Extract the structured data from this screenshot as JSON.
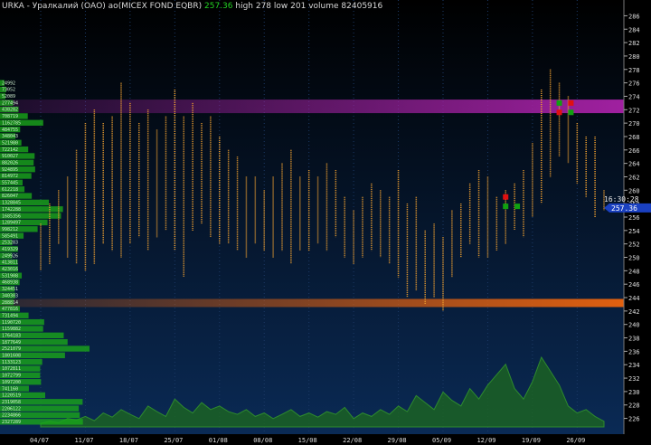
{
  "header": {
    "symbol": "URKA",
    "name": "Уралкалий (ОАО) ао(MICEX FOND EQBR)",
    "last": "257.36",
    "high_text": "high 278",
    "low_text": "low 201",
    "volume_text": "volume 82405916"
  },
  "colors": {
    "background_top": "#000000",
    "background_bottom": "#0a2a55",
    "candle": "#f0a030",
    "resistance_band": "#a020a0",
    "support_band": "#e06010",
    "volume_area": "#1e6a1e",
    "price_tag": "#1a40c0",
    "profile_bar": "#1aa61a"
  },
  "chart_data": {
    "type": "bar",
    "ylim": [
      225,
      287
    ],
    "y_ticks": [
      "286",
      "284",
      "282",
      "280",
      "278",
      "276",
      "274",
      "272",
      "270",
      "268",
      "266",
      "264",
      "262",
      "260",
      "258",
      "256",
      "254",
      "252",
      "250",
      "248",
      "246",
      "244",
      "242",
      "240",
      "238",
      "236",
      "234",
      "232",
      "230",
      "228",
      "226"
    ],
    "x_ticks": [
      "04/07",
      "11/07",
      "18/07",
      "25/07",
      "01/08",
      "08/08",
      "15/08",
      "22/08",
      "29/08",
      "05/09",
      "12/09",
      "19/09",
      "26/09"
    ],
    "x_tick_index": [
      0,
      5,
      10,
      15,
      20,
      25,
      30,
      35,
      40,
      45,
      50,
      55,
      60
    ],
    "ranges": [
      [
        248,
        255
      ],
      [
        249,
        258
      ],
      [
        252,
        260
      ],
      [
        250,
        262
      ],
      [
        249,
        266
      ],
      [
        248,
        270
      ],
      [
        249,
        272
      ],
      [
        252,
        270
      ],
      [
        251,
        271
      ],
      [
        250,
        276
      ],
      [
        252,
        273
      ],
      [
        253,
        270
      ],
      [
        251,
        272
      ],
      [
        253,
        269
      ],
      [
        254,
        271
      ],
      [
        251,
        275
      ],
      [
        247,
        271
      ],
      [
        254,
        273
      ],
      [
        255,
        270
      ],
      [
        253,
        271
      ],
      [
        252,
        268
      ],
      [
        252,
        266
      ],
      [
        251,
        265
      ],
      [
        250,
        262
      ],
      [
        252,
        262
      ],
      [
        251,
        260
      ],
      [
        250,
        262
      ],
      [
        251,
        264
      ],
      [
        249,
        266
      ],
      [
        251,
        262
      ],
      [
        251,
        263
      ],
      [
        252,
        262
      ],
      [
        251,
        264
      ],
      [
        253,
        263
      ],
      [
        250,
        259
      ],
      [
        249,
        257
      ],
      [
        250,
        259
      ],
      [
        251,
        261
      ],
      [
        250,
        260
      ],
      [
        249,
        259
      ],
      [
        247,
        263
      ],
      [
        244,
        258
      ],
      [
        245,
        259
      ],
      [
        243,
        254
      ],
      [
        244,
        255
      ],
      [
        242,
        253
      ],
      [
        247,
        257
      ],
      [
        250,
        258
      ],
      [
        252,
        261
      ],
      [
        250,
        263
      ],
      [
        250,
        262
      ],
      [
        251,
        259
      ],
      [
        252,
        260
      ],
      [
        254,
        261
      ],
      [
        253,
        263
      ],
      [
        256,
        267
      ],
      [
        258,
        275
      ],
      [
        262,
        278
      ],
      [
        265,
        276
      ],
      [
        264,
        274
      ],
      [
        261,
        270
      ],
      [
        259,
        268
      ],
      [
        256,
        268
      ],
      [
        257,
        260
      ]
    ],
    "horizontal_levels": [
      {
        "price": 272.5,
        "label": "272"
      },
      {
        "price": 243.2,
        "label": "243"
      }
    ],
    "last_price_tag": "257.36",
    "time_tag": "16:30:28",
    "volume_profile": {
      "labels": [
        "24992",
        "73052",
        "52089",
        "277494",
        "438282",
        "708719",
        "1162785",
        "484755",
        "348043",
        "521980",
        "722142",
        "910027",
        "882026",
        "924895",
        "814972",
        "557445",
        "612218",
        "826047",
        "1328845",
        "1742288",
        "1685356",
        "1289497",
        "998212",
        "585491",
        "253283",
        "419329",
        "249926",
        "413811",
        "423016",
        "531908",
        "468938",
        "324451",
        "340303",
        "288814",
        "477816",
        "731494",
        "1190720",
        "1159882",
        "1764183",
        "1877649",
        "2521079",
        "1801608",
        "1133123",
        "1072811",
        "1072799",
        "1097200",
        "741160",
        "1220519",
        "2319058",
        "2206122",
        "2234866",
        "2327289"
      ],
      "values": [
        24992,
        73052,
        52089,
        277494,
        438282,
        708719,
        1162785,
        484755,
        348043,
        521980,
        722142,
        910027,
        882026,
        924895,
        814972,
        557445,
        612218,
        826047,
        1328845,
        1742288,
        1685356,
        1289497,
        998212,
        585491,
        253283,
        419329,
        249926,
        413811,
        423016,
        531908,
        468938,
        324451,
        340303,
        288814,
        477816,
        731494,
        1190720,
        1159882,
        1764183,
        1877649,
        2521079,
        1801608,
        1133123,
        1072811,
        1072799,
        1097200,
        741160,
        1220519,
        2319058,
        2206122,
        2234866,
        2327289
      ]
    },
    "volume_series": [
      0.05,
      0.08,
      0.06,
      0.12,
      0.1,
      0.15,
      0.09,
      0.2,
      0.14,
      0.25,
      0.18,
      0.12,
      0.3,
      0.22,
      0.15,
      0.4,
      0.28,
      0.2,
      0.35,
      0.25,
      0.3,
      0.22,
      0.18,
      0.25,
      0.15,
      0.2,
      0.12,
      0.18,
      0.25,
      0.15,
      0.2,
      0.14,
      0.22,
      0.18,
      0.28,
      0.12,
      0.2,
      0.15,
      0.25,
      0.18,
      0.3,
      0.22,
      0.45,
      0.35,
      0.25,
      0.5,
      0.38,
      0.3,
      0.55,
      0.4,
      0.6,
      0.75,
      0.9,
      0.55,
      0.4,
      0.65,
      1.0,
      0.8,
      0.6,
      0.3,
      0.2,
      0.25,
      0.15,
      0.08
    ]
  }
}
